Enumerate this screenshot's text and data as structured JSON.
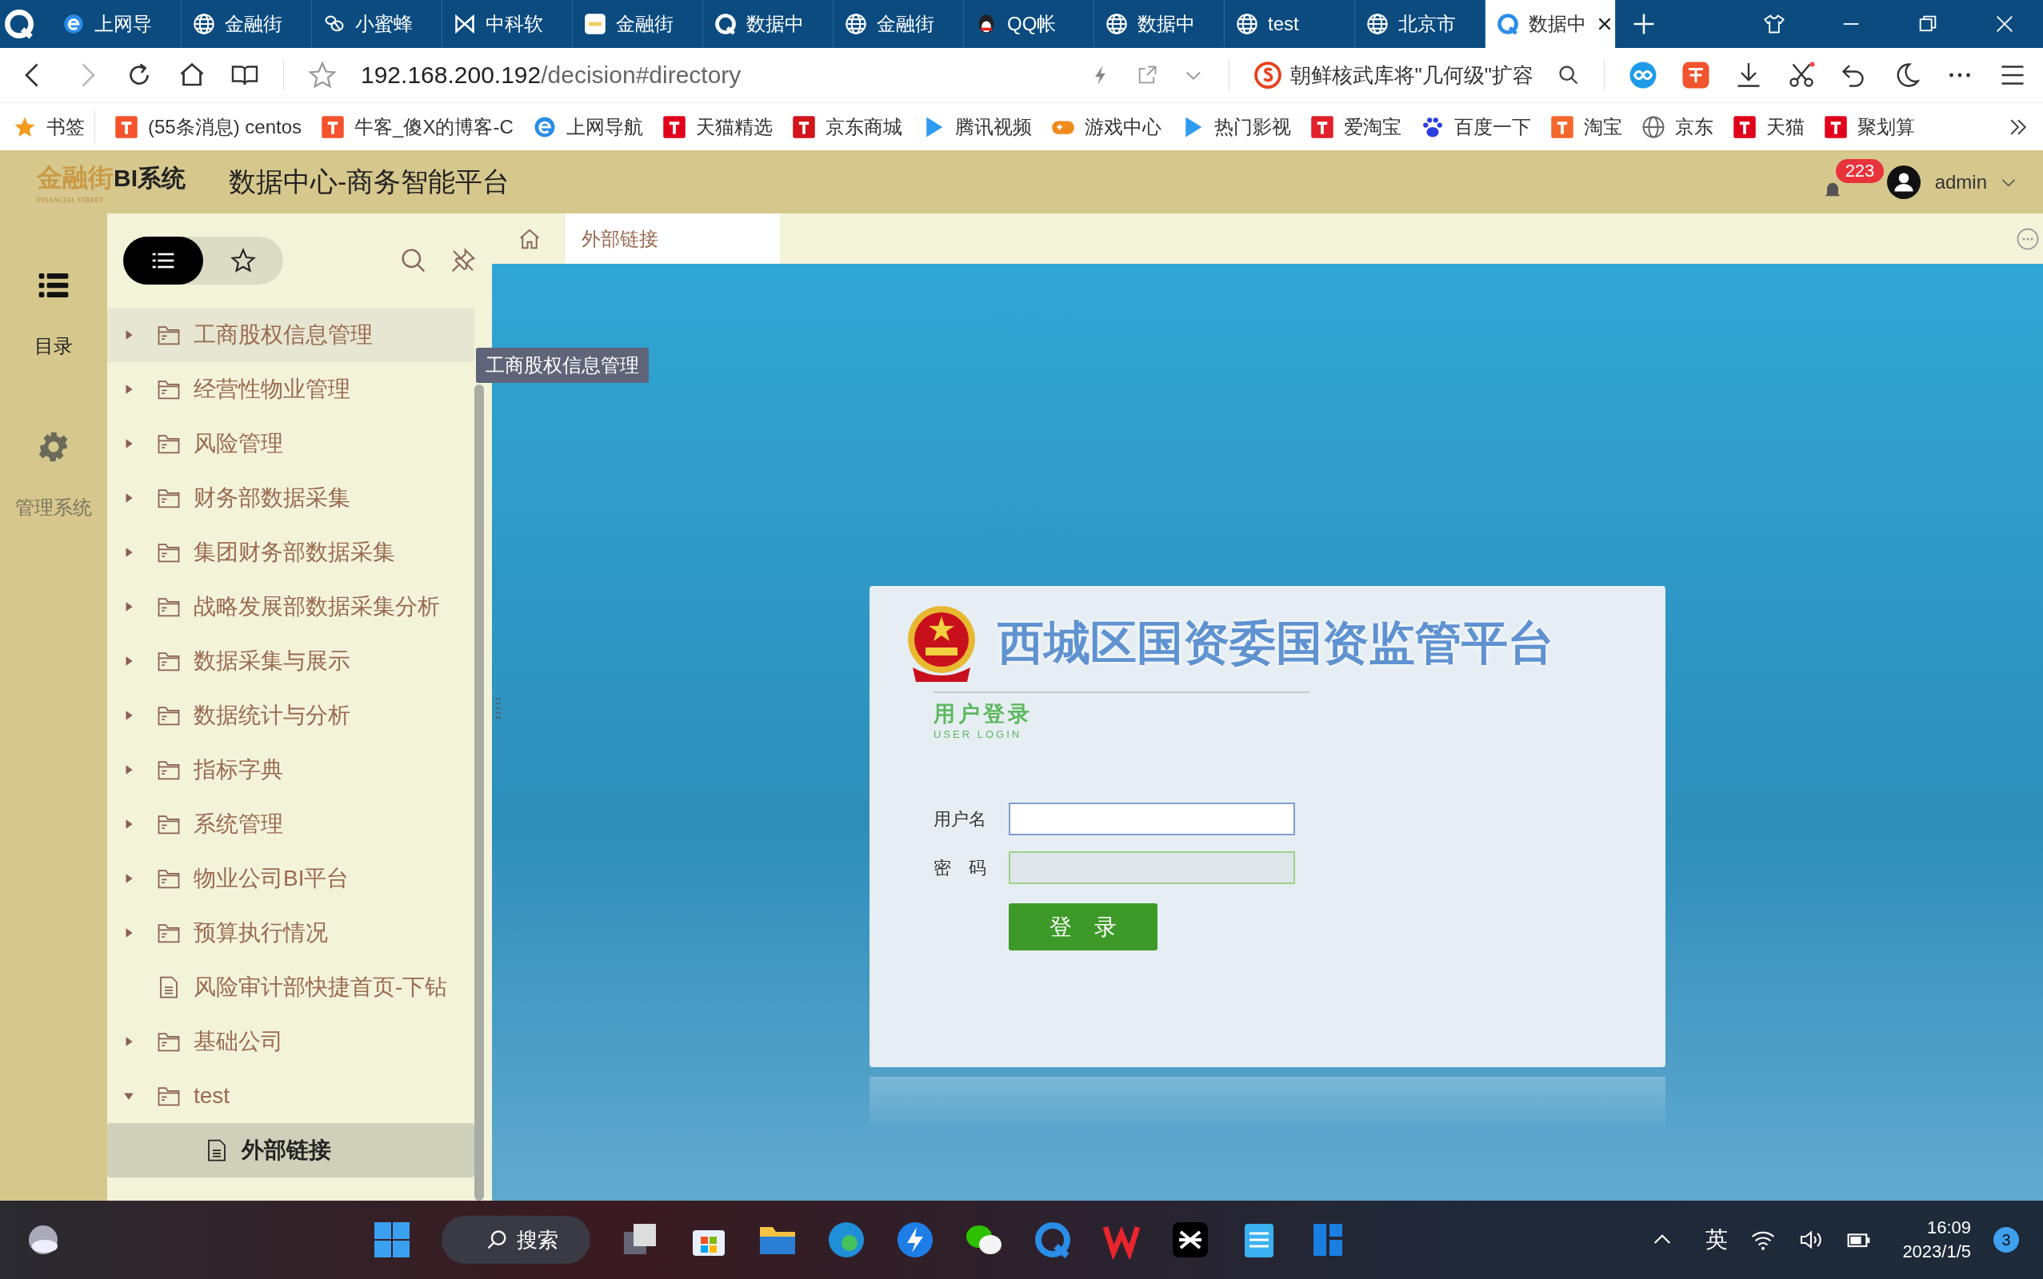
{
  "browser_tabs": [
    {
      "kind": "e",
      "label": "上网导",
      "selected": false
    },
    {
      "kind": "globe",
      "label": "金融街",
      "selected": false
    },
    {
      "kind": "bee",
      "label": "小蜜蜂",
      "selected": false
    },
    {
      "kind": "bowtie",
      "label": "中科软",
      "selected": false
    },
    {
      "kind": "gold",
      "label": "金融街",
      "selected": false
    },
    {
      "kind": "q",
      "label": "数据中",
      "selected": false
    },
    {
      "kind": "globe",
      "label": "金融街",
      "selected": false
    },
    {
      "kind": "penguin",
      "label": "QQ帐",
      "selected": false
    },
    {
      "kind": "globe",
      "label": "数据中",
      "selected": false
    },
    {
      "kind": "globe",
      "label": "test",
      "selected": false
    },
    {
      "kind": "globe",
      "label": "北京市",
      "selected": false
    },
    {
      "kind": "q",
      "label": "数据中",
      "selected": true
    }
  ],
  "address_bar": {
    "host": "192.168.200.192",
    "path": "/decision#directory",
    "search": "朝鲜核武库将\"几何级\"扩容"
  },
  "bookmarks": [
    {
      "kind": "star",
      "label": "书签"
    },
    {
      "kind": "c",
      "label": "(55条消息) centos"
    },
    {
      "kind": "c",
      "label": "牛客_傻X的博客-C"
    },
    {
      "kind": "e",
      "label": "上网导航"
    },
    {
      "kind": "t",
      "label": "天猫精选"
    },
    {
      "kind": "jd",
      "label": "京东商城"
    },
    {
      "kind": "play",
      "label": "腾讯视频"
    },
    {
      "kind": "game",
      "label": "游戏中心"
    },
    {
      "kind": "play",
      "label": "热门影视"
    },
    {
      "kind": "tao",
      "label": "爱淘宝"
    },
    {
      "kind": "paw",
      "label": "百度一下"
    },
    {
      "kind": "tao2",
      "label": "淘宝"
    },
    {
      "kind": "globe",
      "label": "京东"
    },
    {
      "kind": "t",
      "label": "天猫"
    },
    {
      "kind": "t",
      "label": "聚划算"
    }
  ],
  "header": {
    "logo_text": "金融街",
    "logo_suffix": "BI系统",
    "logo_subtext": "FINANCIAL STREET",
    "title": "数据中心-商务智能平台",
    "notification_count": "223",
    "user": "admin"
  },
  "rail": [
    {
      "kind": "list",
      "label": "目录",
      "selected": true
    },
    {
      "kind": "gear",
      "label": "管理系统",
      "selected": false
    }
  ],
  "tree_toolbar": [
    {
      "kind": "list",
      "selected": true
    },
    {
      "kind": "star",
      "selected": false
    }
  ],
  "tree": [
    {
      "kind": "folder",
      "label": "工商股权信息管理",
      "expanded": false,
      "selected": false,
      "hovered": true
    },
    {
      "kind": "folder",
      "label": "经营性物业管理",
      "expanded": false,
      "selected": false
    },
    {
      "kind": "folder",
      "label": "风险管理",
      "expanded": false,
      "selected": false
    },
    {
      "kind": "folder",
      "label": "财务部数据采集",
      "expanded": false,
      "selected": false
    },
    {
      "kind": "folder",
      "label": "集团财务部数据采集",
      "expanded": false,
      "selected": false
    },
    {
      "kind": "folder",
      "label": "战略发展部数据采集分析",
      "expanded": false,
      "selected": false
    },
    {
      "kind": "folder",
      "label": "数据采集与展示",
      "expanded": false,
      "selected": false
    },
    {
      "kind": "folder",
      "label": "数据统计与分析",
      "expanded": false,
      "selected": false
    },
    {
      "kind": "folder",
      "label": "指标字典",
      "expanded": false,
      "selected": false
    },
    {
      "kind": "folder",
      "label": "系统管理",
      "expanded": false,
      "selected": false
    },
    {
      "kind": "folder",
      "label": "物业公司BI平台",
      "expanded": false,
      "selected": false
    },
    {
      "kind": "folder",
      "label": "预算执行情况",
      "expanded": false,
      "selected": false
    },
    {
      "kind": "file",
      "label": "风险审计部快捷首页-下钻",
      "selected": false
    },
    {
      "kind": "folder",
      "label": "基础公司",
      "expanded": false,
      "selected": false
    },
    {
      "kind": "folder",
      "label": "test",
      "expanded": true,
      "selected": false,
      "children": [
        {
          "kind": "file",
          "label": "外部链接",
          "selected": true
        }
      ]
    }
  ],
  "tooltip": "工商股权信息管理",
  "content_tab": "外部链接",
  "login": {
    "title": "西城区国资委国资监管平台",
    "heading": "用户登录",
    "heading_en": "USER LOGIN",
    "username_label": "用户名",
    "password_label": "密　码",
    "button": "登　录"
  },
  "taskbar": {
    "search": "搜索",
    "ime": "英",
    "time": "16:09",
    "date": "2023/1/5",
    "notifications": "3"
  }
}
